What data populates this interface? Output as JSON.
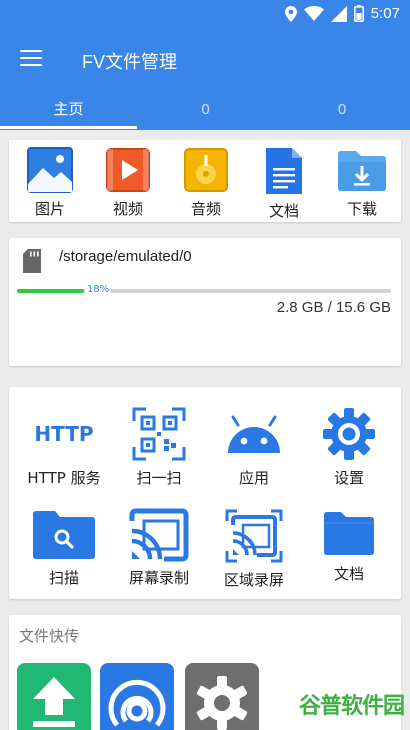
{
  "status_bar": {
    "time": "5:07",
    "icons": [
      "location-icon",
      "wifi-icon",
      "signal-icon",
      "battery-icon"
    ]
  },
  "app_bar": {
    "title": "FV文件管理",
    "menu_icon": "hamburger-menu-icon"
  },
  "tabs": [
    {
      "label": "主页",
      "selected": true
    },
    {
      "label": "0"
    },
    {
      "label": "0"
    }
  ],
  "categories": [
    {
      "label": "图片",
      "icon": "image-icon"
    },
    {
      "label": "视频",
      "icon": "video-icon"
    },
    {
      "label": "音频",
      "icon": "audio-icon"
    },
    {
      "label": "文档",
      "icon": "document-icon"
    },
    {
      "label": "下载",
      "icon": "download-folder-icon"
    }
  ],
  "storage": {
    "path": "/storage/emulated/0",
    "percent_label": "18%",
    "used_fraction": 0.18,
    "size": "2.8 GB  /  15.6 GB",
    "icon": "sd-card-icon"
  },
  "tools": [
    {
      "label": "HTTP 服务",
      "icon": "http-icon",
      "icon_text": "HTTP"
    },
    {
      "label": "扫一扫",
      "icon": "qr-scan-icon"
    },
    {
      "label": "应用",
      "icon": "android-icon"
    },
    {
      "label": "设置",
      "icon": "gear-icon"
    },
    {
      "label": "扫描",
      "icon": "scan-folder-icon"
    },
    {
      "label": "屏幕录制",
      "icon": "cast-icon"
    },
    {
      "label": "区域录屏",
      "icon": "area-record-icon"
    },
    {
      "label": "文档",
      "icon": "folder-icon"
    }
  ],
  "file_transfer": {
    "title": "文件快传",
    "items": [
      "upload-icon",
      "broadcast-icon",
      "gear-icon"
    ]
  },
  "watermark": {
    "text_a": "谷普",
    "text_b": "软件园"
  },
  "colors": {
    "primary": "#3a86e8",
    "progress": "#2ecc40",
    "background": "#ebebeb"
  }
}
